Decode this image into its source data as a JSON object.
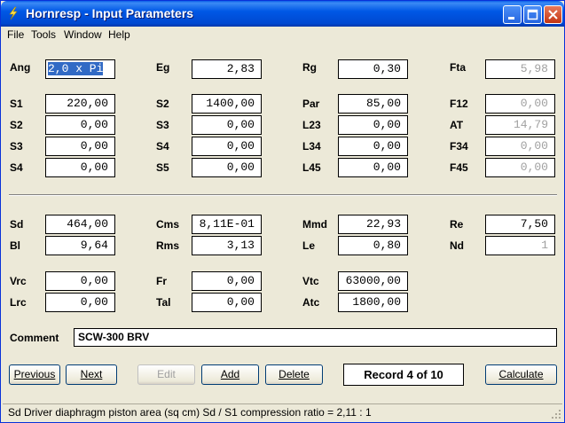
{
  "window": {
    "title": "Hornresp - Input Parameters"
  },
  "menu": [
    "File",
    "Tools",
    "Window",
    "Help"
  ],
  "params": {
    "Ang": {
      "label": "Ang",
      "value": "2,0 x Pi"
    },
    "Eg": {
      "label": "Eg",
      "value": "2,83"
    },
    "Rg": {
      "label": "Rg",
      "value": "0,30"
    },
    "Fta": {
      "label": "Fta",
      "value": "5,98"
    },
    "S1": {
      "label": "S1",
      "value": "220,00"
    },
    "S2a": {
      "label": "S2",
      "value": "1400,00"
    },
    "Par": {
      "label": "Par",
      "value": "85,00"
    },
    "F12": {
      "label": "F12",
      "value": "0,00"
    },
    "S2b": {
      "label": "S2",
      "value": "0,00"
    },
    "S3a": {
      "label": "S3",
      "value": "0,00"
    },
    "L23": {
      "label": "L23",
      "value": "0,00"
    },
    "AT": {
      "label": "AT",
      "value": "14,79"
    },
    "S3b": {
      "label": "S3",
      "value": "0,00"
    },
    "S4a": {
      "label": "S4",
      "value": "0,00"
    },
    "L34": {
      "label": "L34",
      "value": "0,00"
    },
    "F34": {
      "label": "F34",
      "value": "0,00"
    },
    "S4b": {
      "label": "S4",
      "value": "0,00"
    },
    "S5": {
      "label": "S5",
      "value": "0,00"
    },
    "L45": {
      "label": "L45",
      "value": "0,00"
    },
    "F45": {
      "label": "F45",
      "value": "0,00"
    },
    "Sd": {
      "label": "Sd",
      "value": "464,00"
    },
    "Cms": {
      "label": "Cms",
      "value": "8,11E-01"
    },
    "Mmd": {
      "label": "Mmd",
      "value": "22,93"
    },
    "Re": {
      "label": "Re",
      "value": "7,50"
    },
    "Bl": {
      "label": "Bl",
      "value": "9,64"
    },
    "Rms": {
      "label": "Rms",
      "value": "3,13"
    },
    "Le": {
      "label": "Le",
      "value": "0,80"
    },
    "Nd": {
      "label": "Nd",
      "value": "1"
    },
    "Vrc": {
      "label": "Vrc",
      "value": "0,00"
    },
    "Fr": {
      "label": "Fr",
      "value": "0,00"
    },
    "Vtc": {
      "label": "Vtc",
      "value": "63000,00"
    },
    "Lrc": {
      "label": "Lrc",
      "value": "0,00"
    },
    "Tal": {
      "label": "Tal",
      "value": "0,00"
    },
    "Atc": {
      "label": "Atc",
      "value": "1800,00"
    }
  },
  "comment": {
    "label": "Comment",
    "value": "SCW-300 BRV"
  },
  "buttons": {
    "previous": "Previous",
    "next": "Next",
    "edit": "Edit",
    "add": "Add",
    "delete": "Delete",
    "calculate": "Calculate"
  },
  "record": "Record 4 of 10",
  "status": "Sd   Driver diaphragm piston area  (sq cm)   Sd / S1 compression ratio = 2,11 : 1"
}
